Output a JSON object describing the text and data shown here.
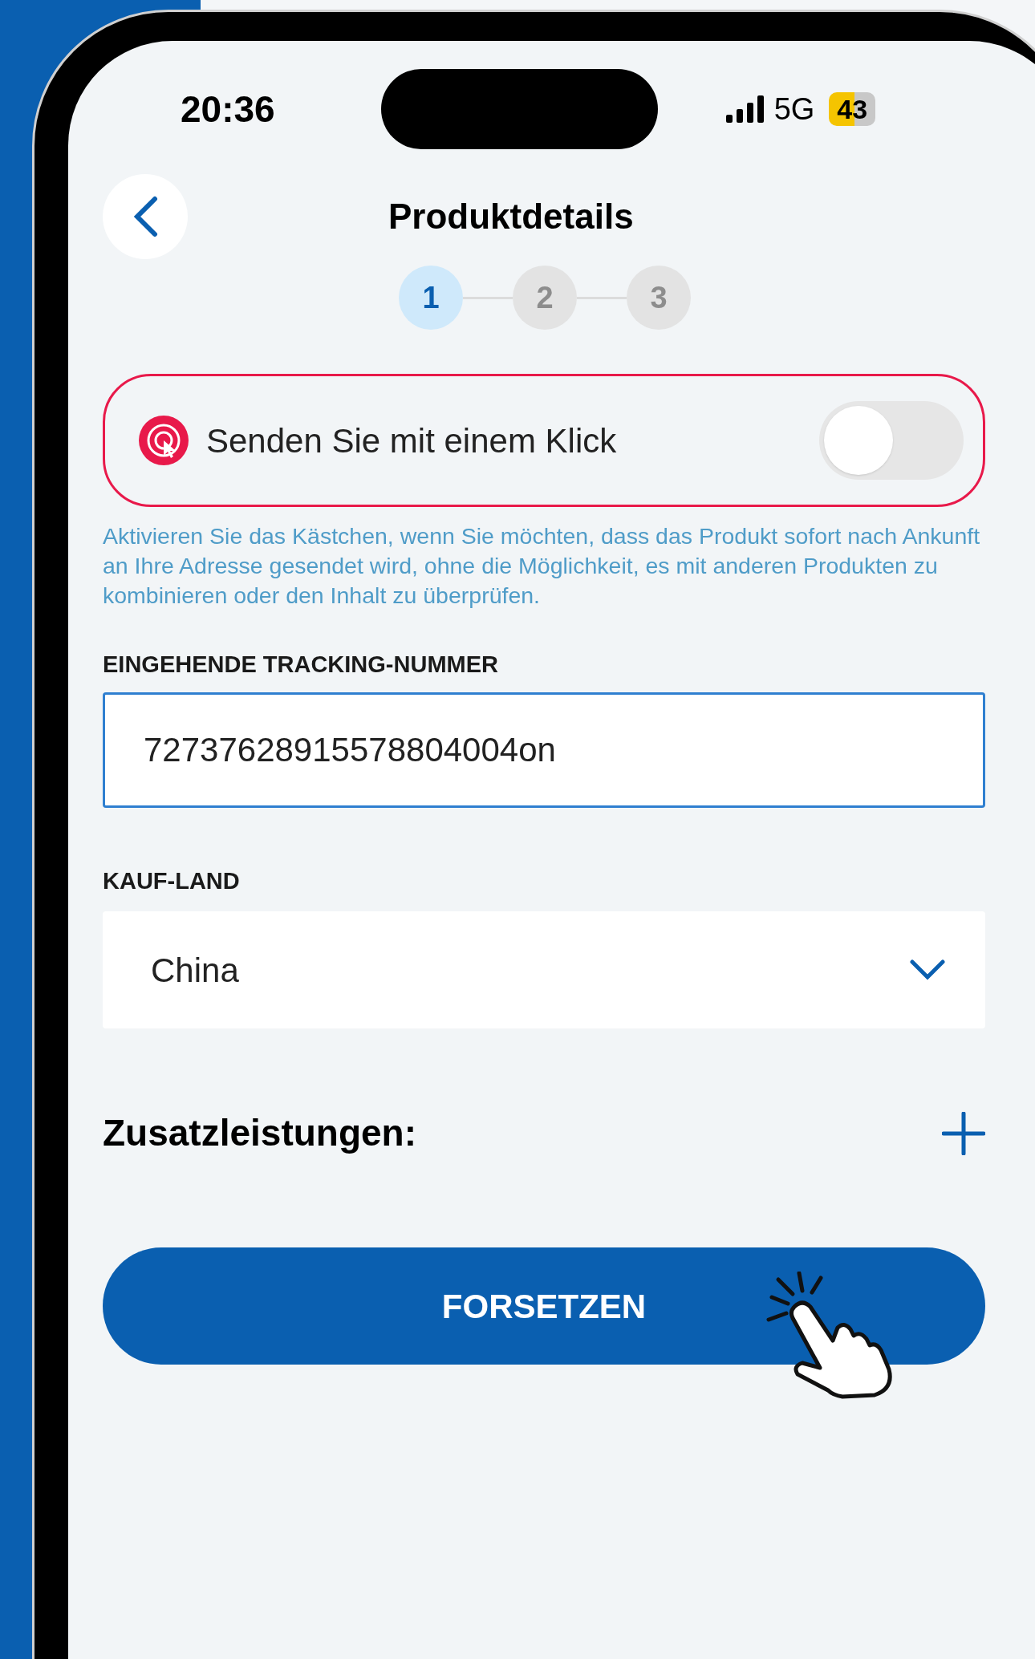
{
  "status_bar": {
    "time": "20:36",
    "network": "5G",
    "battery": "43"
  },
  "header": {
    "title": "Produktdetails"
  },
  "steps": [
    {
      "label": "1",
      "selected": true
    },
    {
      "label": "2",
      "selected": false
    },
    {
      "label": "3",
      "selected": false
    }
  ],
  "one_click": {
    "label": "Senden Sie mit einem Klick",
    "on": false
  },
  "hint": "Aktivieren Sie das Kästchen, wenn Sie möchten, dass das Produkt sofort nach Ankunft an Ihre Adresse gesendet wird, ohne die Möglichkeit, es mit anderen Produkten zu kombinieren oder den Inhalt zu überprüfen.",
  "tracking": {
    "label": "EINGEHENDE TRACKING-NUMMER",
    "value": "72737628915578804004on"
  },
  "country": {
    "label": "KAUF-LAND",
    "value": "China"
  },
  "extras": {
    "label": "Zusatzleistungen:"
  },
  "button": {
    "label": "FORSETZEN"
  }
}
